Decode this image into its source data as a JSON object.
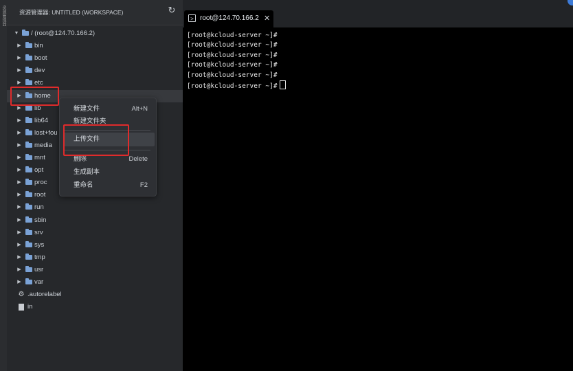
{
  "sidebar": {
    "title": "资源管理器: UNTITLED (WORKSPACE)",
    "activity_label": "资源管理器",
    "root": "/ (root@124.70.166.2)",
    "folders": [
      "bin",
      "boot",
      "dev",
      "etc",
      "home",
      "lib",
      "lib64",
      "lost+fou",
      "media",
      "mnt",
      "opt",
      "proc",
      "root",
      "run",
      "sbin",
      "srv",
      "sys",
      "tmp",
      "usr",
      "var"
    ],
    "files": [
      ".autorelabel",
      "in"
    ],
    "selected_folder": "home"
  },
  "context_menu": {
    "items": [
      {
        "label": "新建文件",
        "shortcut": "Alt+N"
      },
      {
        "label": "新建文件夹",
        "shortcut": ""
      },
      {
        "label": "上传文件",
        "shortcut": ""
      },
      {
        "label": "删除",
        "shortcut": "Delete"
      },
      {
        "label": "生成副本",
        "shortcut": ""
      },
      {
        "label": "重命名",
        "shortcut": "F2"
      }
    ],
    "hovered": "上传文件"
  },
  "tabs": [
    {
      "label": "root@124.70.166.2",
      "icon": "terminal-icon",
      "close": "✕"
    }
  ],
  "terminal": {
    "lines": [
      "[root@kcloud-server ~]#",
      "[root@kcloud-server ~]#",
      "[root@kcloud-server ~]#",
      "[root@kcloud-server ~]#",
      "[root@kcloud-server ~]#",
      "[root@kcloud-server ~]#"
    ]
  },
  "colors": {
    "highlight": "#e02b2b",
    "folder": "#7aa2d6",
    "terminal_bg": "#000000"
  }
}
